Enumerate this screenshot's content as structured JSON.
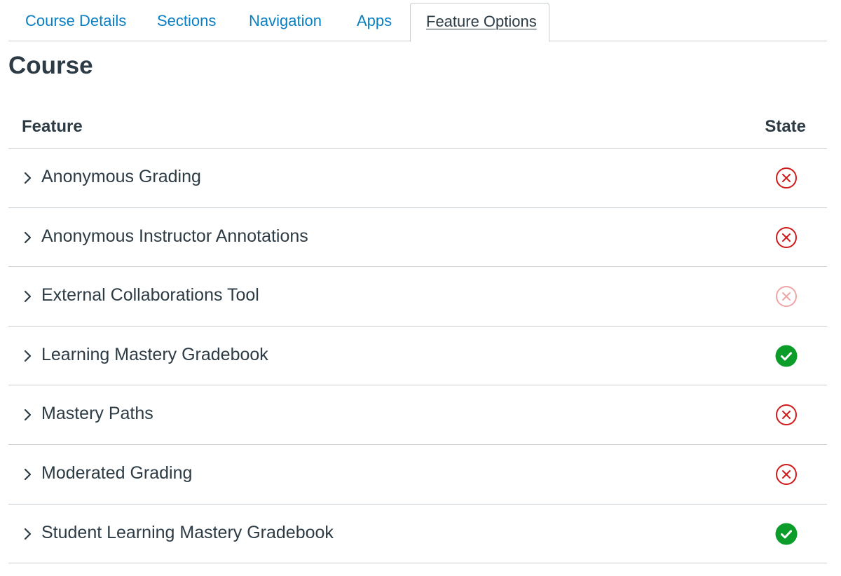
{
  "tabs": [
    {
      "label": "Course Details",
      "active": false
    },
    {
      "label": "Sections",
      "active": false
    },
    {
      "label": "Navigation",
      "active": false
    },
    {
      "label": "Apps",
      "active": false
    },
    {
      "label": "Feature Options",
      "active": true
    }
  ],
  "heading": "Course",
  "table": {
    "header_feature": "Feature",
    "header_state": "State",
    "rows": [
      {
        "label": "Anonymous Grading",
        "state": "off",
        "state_icon": "x-circle-icon"
      },
      {
        "label": "Anonymous Instructor Annotations",
        "state": "off",
        "state_icon": "x-circle-icon"
      },
      {
        "label": "External Collaborations Tool",
        "state": "off-locked",
        "state_icon": "x-circle-icon"
      },
      {
        "label": "Learning Mastery Gradebook",
        "state": "on",
        "state_icon": "check-circle-icon"
      },
      {
        "label": "Mastery Paths",
        "state": "off",
        "state_icon": "x-circle-icon"
      },
      {
        "label": "Moderated Grading",
        "state": "off",
        "state_icon": "x-circle-icon"
      },
      {
        "label": "Student Learning Mastery Gradebook",
        "state": "on",
        "state_icon": "check-circle-icon"
      }
    ]
  },
  "colors": {
    "link": "#0a7fc2",
    "text": "#2d3b45",
    "off": "#d01a19",
    "off_disabled": "#efa5a5",
    "on": "#0b9c2a",
    "divider": "#c7cdd1"
  }
}
